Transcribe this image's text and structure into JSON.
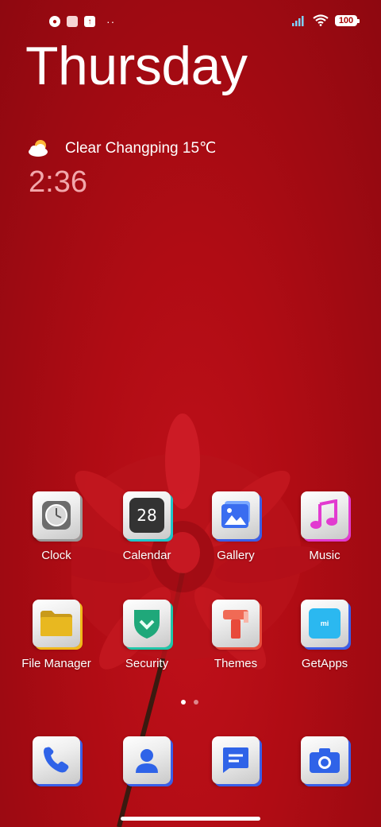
{
  "status_bar": {
    "battery": "100",
    "icons": [
      "notification-icon",
      "square-icon",
      "upload-icon",
      "signal-icon",
      "wifi-icon",
      "battery-icon"
    ],
    "more": "··"
  },
  "lockscreen": {
    "day": "Thursday",
    "weather_text": "Clear Changping 15℃",
    "time": "2:36"
  },
  "apps_row1": [
    {
      "label": "Clock",
      "icon": "clock-icon"
    },
    {
      "label": "Calendar",
      "icon": "calendar-icon",
      "icon_text": "28"
    },
    {
      "label": "Gallery",
      "icon": "gallery-icon"
    },
    {
      "label": "Music",
      "icon": "music-icon"
    }
  ],
  "apps_row2": [
    {
      "label": "File Manager",
      "icon": "folder-icon"
    },
    {
      "label": "Security",
      "icon": "shield-icon"
    },
    {
      "label": "Themes",
      "icon": "themes-icon"
    },
    {
      "label": "GetApps",
      "icon": "getapps-icon",
      "icon_text": "mi"
    }
  ],
  "dock": [
    {
      "icon": "phone-icon"
    },
    {
      "icon": "contacts-icon"
    },
    {
      "icon": "messages-icon"
    },
    {
      "icon": "camera-icon"
    }
  ],
  "page_indicator": {
    "pages": 2,
    "active": 1
  },
  "colors": {
    "background": "#b00c14",
    "accent_blue": "#3a5fe8",
    "accent_teal": "#1fc6c9",
    "accent_magenta": "#e23ad0"
  }
}
